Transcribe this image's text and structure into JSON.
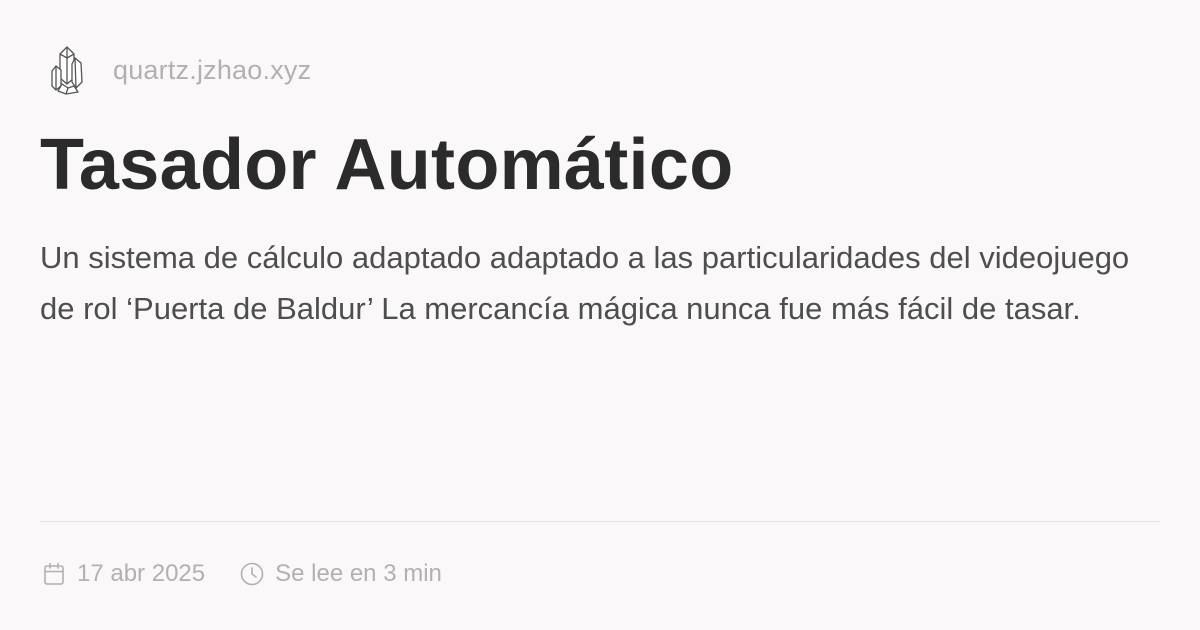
{
  "site": {
    "url": "quartz.jzhao.xyz",
    "logo_icon": "crystal-cluster-icon"
  },
  "article": {
    "title": "Tasador Automático",
    "description": "Un sistema de cálculo adaptado adaptado a las particularidades del videojuego de rol ‘Puerta de Baldur’ La mercancía mágica nunca fue más fácil de tasar."
  },
  "meta": {
    "date": "17 abr 2025",
    "date_icon": "calendar-icon",
    "reading_time": "Se lee en 3 min",
    "reading_icon": "clock-icon"
  },
  "colors": {
    "background": "#faf8f8",
    "title": "#2b2b2b",
    "body_text": "#4e4e4e",
    "muted": "#b3b0b0",
    "divider": "#e6e3e3"
  }
}
